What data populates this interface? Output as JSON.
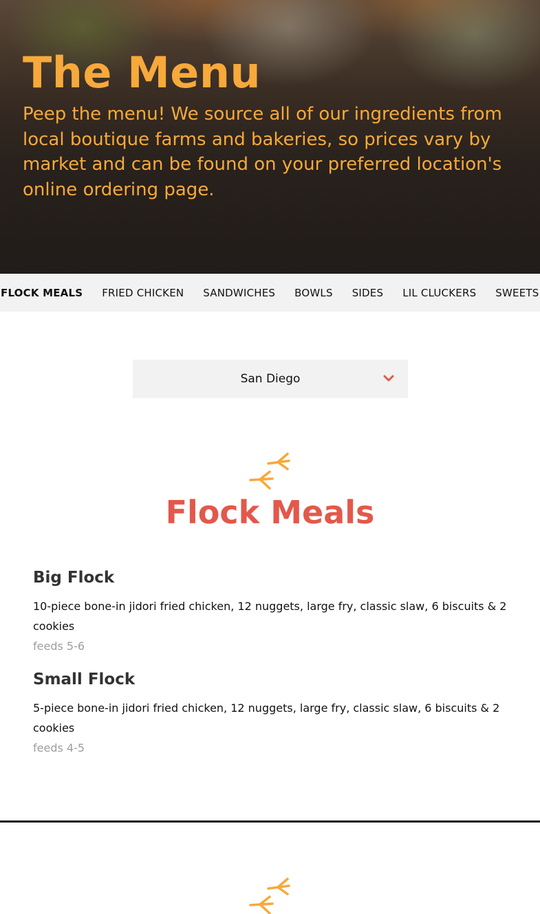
{
  "hero": {
    "title": "The Menu",
    "text": "Peep the menu! We source all of our ingredients from local boutique farms and bakeries, so prices vary by market and can be found on your preferred location's online ordering page."
  },
  "categories": [
    "FLOCK MEALS",
    "FRIED CHICKEN",
    "SANDWICHES",
    "BOWLS",
    "SIDES",
    "LIL CLUCKERS",
    "SWEETS"
  ],
  "location": {
    "selected": "San Diego"
  },
  "sections": [
    {
      "title": "Flock Meals",
      "items": [
        {
          "name": "Big Flock",
          "description": "10-piece bone-in jidori fried chicken, 12 nuggets, large fry, classic slaw, 6 biscuits & 2 cookies",
          "feeds": "feeds 5-6"
        },
        {
          "name": "Small Flock",
          "description": "5-piece bone-in jidori fried chicken, 12 nuggets, large fry, classic slaw, 6 biscuits & 2 cookies",
          "feeds": "feeds 4-5"
        }
      ]
    }
  ],
  "colors": {
    "accent_orange": "#f7a93b",
    "title_red": "#e3584b",
    "nav_bg": "#f1f2f1"
  },
  "icons": [
    "chevron-down-icon",
    "chicken-feet-icon"
  ]
}
